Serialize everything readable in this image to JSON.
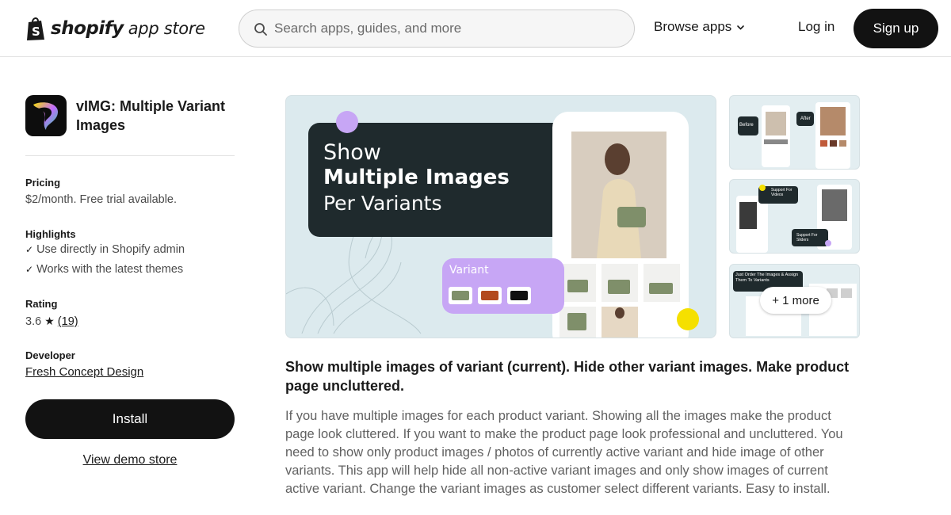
{
  "header": {
    "brand": "shopify",
    "brand_suffix": "app store",
    "search_placeholder": "Search apps, guides, and more",
    "browse_label": "Browse apps",
    "login_label": "Log in",
    "signup_label": "Sign up"
  },
  "app": {
    "name": "vIMG: Multiple Variant Images",
    "pricing_label": "Pricing",
    "pricing_value": "$2/month. Free trial available.",
    "highlights_label": "Highlights",
    "highlights": [
      "Use directly in Shopify admin",
      "Works with the latest themes"
    ],
    "rating_label": "Rating",
    "rating_value": "3.6",
    "rating_count": "(19)",
    "developer_label": "Developer",
    "developer_name": "Fresh Concept Design",
    "install_label": "Install",
    "demo_label": "View demo store"
  },
  "gallery": {
    "hero": {
      "line1": "Show",
      "line2": "Multiple Images",
      "line3": "Per Variants",
      "variant_label": "Variant"
    },
    "thumb1": {
      "before": "Before",
      "after": "After"
    },
    "thumb2": {
      "video": "Support For Videos",
      "sliders": "Support For Sliders"
    },
    "thumb3": {
      "caption": "Just Order The Images & Assign Them To Variants"
    },
    "more_label": "+ 1 more"
  },
  "description": {
    "headline": "Show multiple images of variant (current). Hide other variant images. Make product page uncluttered.",
    "body": "If you have multiple images for each product variant. Showing all the images make the product page look cluttered. If you want to make the product page look professional and uncluttered. You need to show only product images / photos of currently active variant and hide image of other variants. This app will help hide all non-active variant images and only show images of current active variant. Change the variant images as customer select different variants. Easy to install."
  },
  "colors": {
    "primary_button": "#121212",
    "hero_bg": "#dceaee",
    "hero_dark": "#1f2a2d",
    "accent_purple": "#c7a6f5",
    "accent_yellow": "#f5e000"
  }
}
